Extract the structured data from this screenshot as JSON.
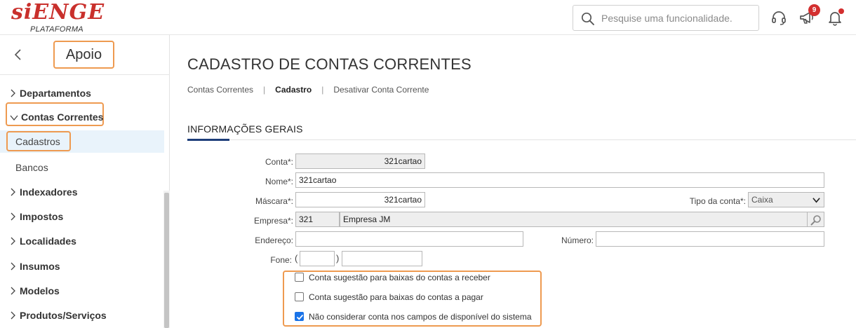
{
  "header": {
    "logo_text": "siENGE",
    "logo_subtext": "PLATAFORMA",
    "search_placeholder": "Pesquise uma funcionalidade.",
    "notification_count": "9",
    "icons": [
      "search-icon",
      "headset-icon",
      "megaphone-icon",
      "bell-icon"
    ]
  },
  "sidebar": {
    "title": "Apoio",
    "items": [
      {
        "label": "Departamentos",
        "expanded": false
      },
      {
        "label": "Contas Correntes",
        "expanded": true
      },
      {
        "label": "Cadastros",
        "sub": true,
        "active": true
      },
      {
        "label": "Bancos",
        "sub": true
      },
      {
        "label": "Indexadores",
        "expanded": false
      },
      {
        "label": "Impostos",
        "expanded": false
      },
      {
        "label": "Localidades",
        "expanded": false
      },
      {
        "label": "Insumos",
        "expanded": false
      },
      {
        "label": "Modelos",
        "expanded": false
      },
      {
        "label": "Produtos/Serviços",
        "expanded": false
      }
    ]
  },
  "main": {
    "title": "CADASTRO DE CONTAS CORRENTES",
    "breadcrumb": [
      "Contas Correntes",
      "Cadastro",
      "Desativar Conta Corrente"
    ],
    "section_title": "INFORMAÇÕES GERAIS",
    "form": {
      "conta_label": "Conta*:",
      "conta_value": "321cartao",
      "nome_label": "Nome*:",
      "nome_value": "321cartao",
      "mascara_label": "Máscara*:",
      "mascara_value": "321cartao",
      "tipo_label": "Tipo da conta*:",
      "tipo_value": "Caixa",
      "empresa_label": "Empresa*:",
      "empresa_code": "321",
      "empresa_name": "Empresa JM",
      "endereco_label": "Endereço:",
      "endereco_value": "",
      "numero_label": "Número:",
      "numero_value": "",
      "fone_label": "Fone:",
      "fone_open": "(",
      "fone_close": ")",
      "fone_ddd": "",
      "fone_number": ""
    },
    "checkboxes": [
      {
        "label": "Conta sugestão para baixas do contas a receber",
        "checked": false
      },
      {
        "label": "Conta sugestão para baixas do contas a pagar",
        "checked": false
      },
      {
        "label": "Não considerar conta nos campos de disponível do sistema",
        "checked": true
      }
    ]
  },
  "colors": {
    "brand": "#c9302c",
    "highlight": "#ee9a50",
    "accent": "#1e3e7a",
    "badge": "#d32f2f",
    "checkbox": "#1a73e8"
  }
}
